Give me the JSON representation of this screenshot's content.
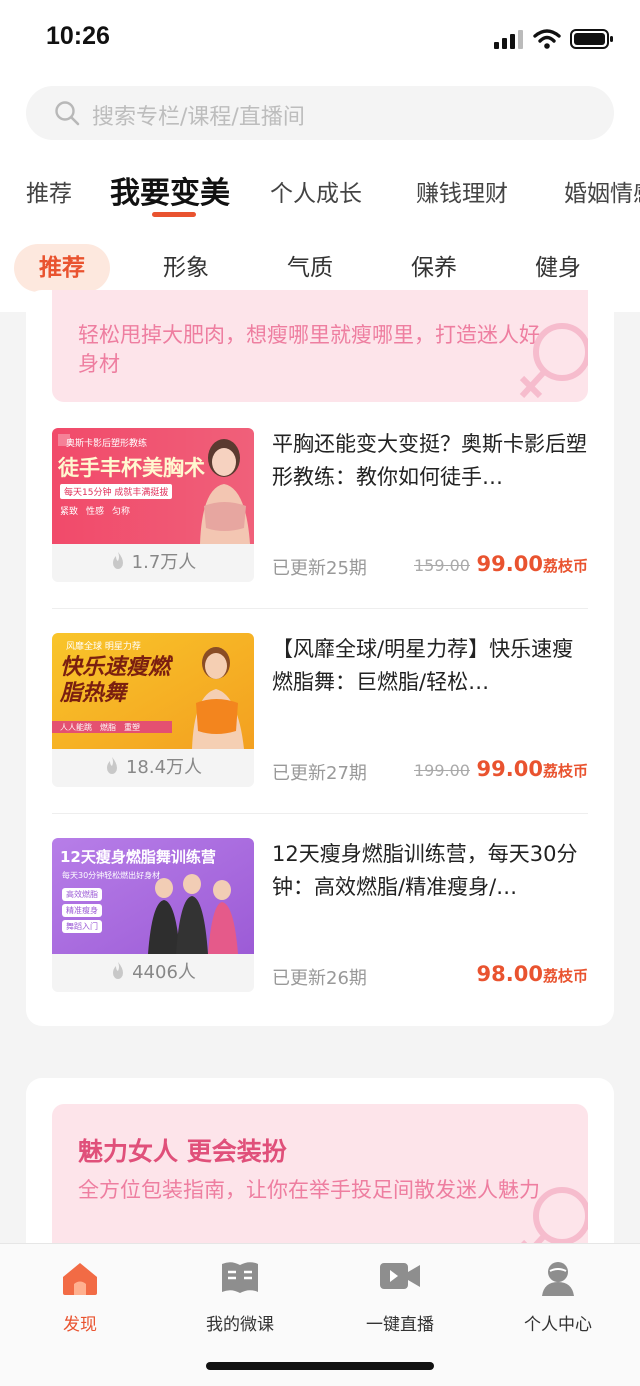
{
  "status_bar": {
    "time": "10:26"
  },
  "search": {
    "placeholder": "搜索专栏/课程/直播间"
  },
  "tabs": [
    {
      "label": "推荐"
    },
    {
      "label": "我要变美",
      "active": true
    },
    {
      "label": "个人成长"
    },
    {
      "label": "赚钱理财"
    },
    {
      "label": "婚姻情感"
    }
  ],
  "subtabs": [
    {
      "label": "推荐",
      "active": true
    },
    {
      "label": "形象"
    },
    {
      "label": "气质"
    },
    {
      "label": "保养"
    },
    {
      "label": "健身"
    }
  ],
  "section1": {
    "banner_desc": "轻松甩掉大肥肉，想瘦哪里就瘦哪里，打造迷人好身材",
    "courses": [
      {
        "thumb": {
          "top": "奥斯卡影后塑形教练",
          "main": "徒手丰杯美胸术",
          "sub": "每天15分钟 成就丰满挺拔",
          "tags": [
            "紧致",
            "性感",
            "匀称"
          ]
        },
        "count": "1.7万人",
        "title": "平胸还能变大变挺？奥斯卡影后塑形教练：教你如何徒手…",
        "updated": "已更新25期",
        "original_price": "159.00",
        "price": "99.00",
        "unit": "荔枝币"
      },
      {
        "thumb": {
          "top": "风靡全球 明星力荐",
          "main": "快乐速瘦燃脂热舞",
          "tags": [
            "人人能跳",
            "燃脂",
            "重塑"
          ]
        },
        "count": "18.4万人",
        "title": "【风靡全球/明星力荐】快乐速瘦燃脂舞：巨燃脂/轻松…",
        "updated": "已更新27期",
        "original_price": "199.00",
        "price": "99.00",
        "unit": "荔枝币"
      },
      {
        "thumb": {
          "main": "12天瘦身燃脂舞训练营",
          "sub": "每天30分钟轻松燃出好身材",
          "tags": [
            "高效燃脂",
            "精准瘦身",
            "舞蹈入门"
          ]
        },
        "count": "4406人",
        "title": "12天瘦身燃脂训练营，每天30分钟：高效燃脂/精准瘦身/…",
        "updated": "已更新26期",
        "original_price": "",
        "price": "98.00",
        "unit": "荔枝币"
      }
    ]
  },
  "section2": {
    "banner_title": "魅力女人 更会装扮",
    "banner_desc": "全方位包装指南，让你在举手投足间散发迷人魅力"
  },
  "bottom_nav": [
    {
      "label": "发现",
      "icon": "home-icon",
      "active": true
    },
    {
      "label": "我的微课",
      "icon": "book-icon"
    },
    {
      "label": "一键直播",
      "icon": "video-camera-icon"
    },
    {
      "label": "个人中心",
      "icon": "user-icon"
    }
  ],
  "colors": {
    "accent": "#e9532f",
    "banner_bg": "#fde4ea",
    "banner_text": "#e0507a"
  }
}
